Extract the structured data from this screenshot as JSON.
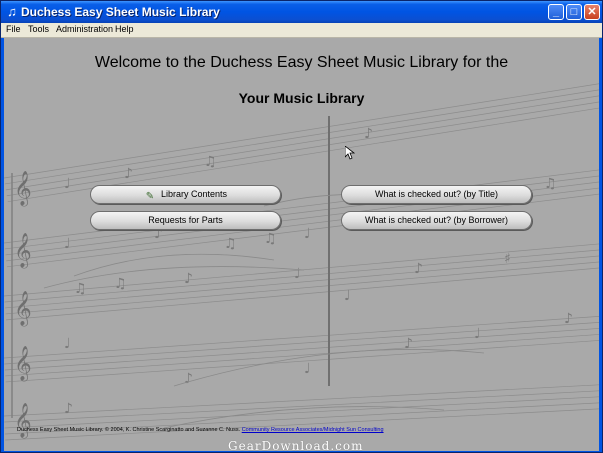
{
  "window": {
    "title": "Duchess Easy Sheet Music Library",
    "app_icon": "music-note-icon",
    "controls": {
      "minimize": "_",
      "maximize": "□",
      "close": "✕"
    }
  },
  "menu": [
    "File",
    "Tools",
    "Administration",
    "Help"
  ],
  "main": {
    "welcome": "Welcome to the Duchess Easy Sheet Music Library for the",
    "library_name": "Your Music Library"
  },
  "buttons": {
    "library_contents": "Library Contents",
    "requests_for_parts": "Requests for Parts",
    "checked_out_title": "What is checked out? (by Title)",
    "checked_out_borrower": "What is checked out? (by Borrower)"
  },
  "footer": {
    "copyright": "Duchess Easy Sheet Music Library.  © 2004,  K. Christine Scarginatto and Suzanne C. Nuss.",
    "link": "Community Resource Associates/Midnight Sun Consulting"
  },
  "watermark": "GearDownload.com",
  "colors": {
    "titlebar": "#0054e3",
    "menubar": "#ece9d8",
    "background": "#a9a9a9",
    "link": "#0000cc"
  }
}
